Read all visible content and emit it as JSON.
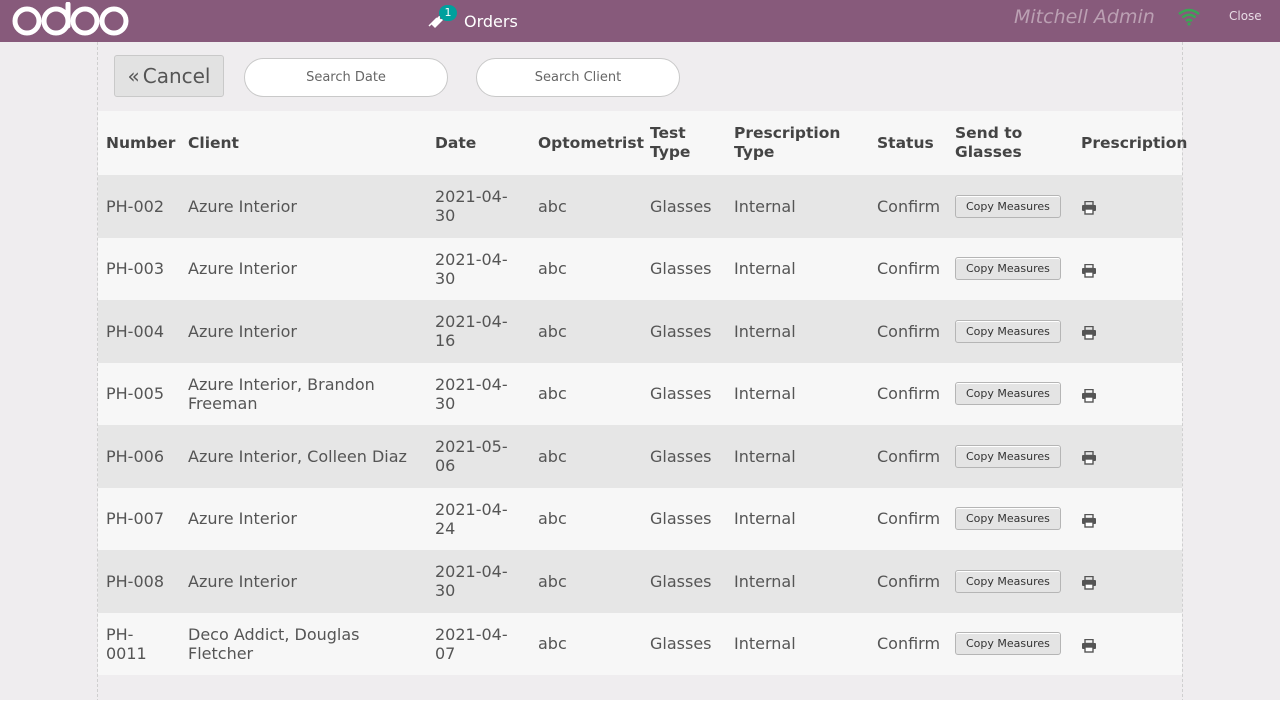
{
  "topbar": {
    "logo_text": "odoo",
    "orders_badge": "1",
    "orders_label": "Orders",
    "user_name": "Mitchell Admin",
    "close_label": "Close"
  },
  "toolbar": {
    "cancel_label": "Cancel",
    "search_date_placeholder": "Search Date",
    "search_client_placeholder": "Search Client"
  },
  "table": {
    "headers": {
      "number": "Number",
      "client": "Client",
      "date": "Date",
      "optometrist": "Optometrist",
      "test_type": "Test Type",
      "prescription_type": "Prescription Type",
      "status": "Status",
      "send_to_glasses": "Send to Glasses",
      "prescription": "Prescription"
    },
    "rows": [
      {
        "number": "PH-002",
        "client": "Azure Interior",
        "date": "2021-04-30",
        "optometrist": "abc",
        "test_type": "Glasses",
        "prescription_type": "Internal",
        "status": "Confirm",
        "action": "Copy Measures"
      },
      {
        "number": "PH-003",
        "client": "Azure Interior",
        "date": "2021-04-30",
        "optometrist": "abc",
        "test_type": "Glasses",
        "prescription_type": "Internal",
        "status": "Confirm",
        "action": "Copy Measures"
      },
      {
        "number": "PH-004",
        "client": "Azure Interior",
        "date": "2021-04-16",
        "optometrist": "abc",
        "test_type": "Glasses",
        "prescription_type": "Internal",
        "status": "Confirm",
        "action": "Copy Measures"
      },
      {
        "number": "PH-005",
        "client": "Azure Interior, Brandon Freeman",
        "date": "2021-04-30",
        "optometrist": "abc",
        "test_type": "Glasses",
        "prescription_type": "Internal",
        "status": "Confirm",
        "action": "Copy Measures"
      },
      {
        "number": "PH-006",
        "client": "Azure Interior, Colleen Diaz",
        "date": "2021-05-06",
        "optometrist": "abc",
        "test_type": "Glasses",
        "prescription_type": "Internal",
        "status": "Confirm",
        "action": "Copy Measures"
      },
      {
        "number": "PH-007",
        "client": "Azure Interior",
        "date": "2021-04-24",
        "optometrist": "abc",
        "test_type": "Glasses",
        "prescription_type": "Internal",
        "status": "Confirm",
        "action": "Copy Measures"
      },
      {
        "number": "PH-008",
        "client": "Azure Interior",
        "date": "2021-04-30",
        "optometrist": "abc",
        "test_type": "Glasses",
        "prescription_type": "Internal",
        "status": "Confirm",
        "action": "Copy Measures"
      },
      {
        "number": "PH-0011",
        "client": "Deco Addict, Douglas Fletcher",
        "date": "2021-04-07",
        "optometrist": "abc",
        "test_type": "Glasses",
        "prescription_type": "Internal",
        "status": "Confirm",
        "action": "Copy Measures"
      }
    ]
  },
  "icons": {
    "orders": "tag-icon",
    "connection": "wifi-icon",
    "print": "print-icon"
  },
  "colors": {
    "topbar": "#875a7b",
    "badge": "#00a09d",
    "wifi": "#3aa655"
  }
}
